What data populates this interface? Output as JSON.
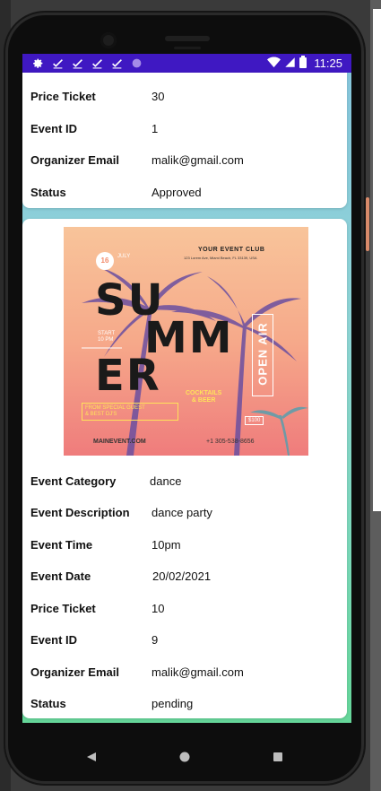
{
  "status_bar": {
    "time": "11:25",
    "icons": [
      "gear-icon",
      "check-icon",
      "check-icon",
      "check-icon",
      "check-icon",
      "circle-icon"
    ],
    "bar_color": "#3f18c2"
  },
  "event_cards": [
    {
      "fields": [
        {
          "label": "Price Ticket",
          "value": "30"
        },
        {
          "label": "Event ID",
          "value": "1"
        },
        {
          "label": "Organizer Email",
          "value": "malik@gmail.com"
        },
        {
          "label": "Status",
          "value": "Approved"
        }
      ]
    },
    {
      "poster": {
        "club": "YOUR EVENT CLUB",
        "address": "123 Lorem Ave, Miami Beach, FL 33139, USA",
        "day": "16",
        "month": "JULY",
        "headline_1": "SU",
        "headline_2": "MM",
        "headline_3": "ER",
        "start": "START",
        "start_time": "10 PM",
        "open_air": "OPEN AIR",
        "cocktails": "COCKTAILS",
        "cocktails_2": "& BEER",
        "guest_1": "FROM SPECIAL GUEST",
        "guest_2": "& BEST DJ'S",
        "price": "$100",
        "website": "MAINEVENT.COM",
        "phone": "+1 305-538-8656"
      },
      "fields": [
        {
          "label": "Event Category",
          "value": "dance"
        },
        {
          "label": "Event Description",
          "value": "dance party"
        },
        {
          "label": "Event Time",
          "value": "10pm"
        },
        {
          "label": "Event Date",
          "value": "20/02/2021"
        },
        {
          "label": "Price Ticket",
          "value": "10"
        },
        {
          "label": "Event ID",
          "value": "9"
        },
        {
          "label": "Organizer Email",
          "value": "malik@gmail.com"
        },
        {
          "label": "Status",
          "value": "pending"
        }
      ]
    }
  ],
  "nav": {
    "back": "back-triangle-icon",
    "home": "home-circle-icon",
    "recents": "recents-square-icon"
  }
}
